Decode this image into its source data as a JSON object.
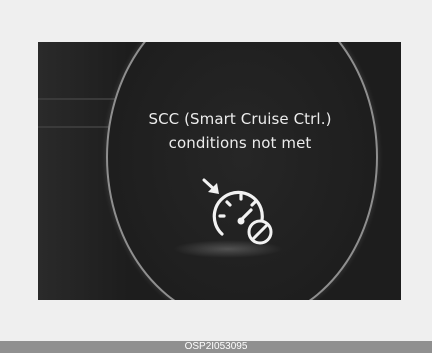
{
  "display": {
    "message_line1": "SCC (Smart Cruise Ctrl.)",
    "message_line2": "conditions not met",
    "icon": "cruise-control-unavailable-icon"
  },
  "caption": {
    "code": "OSP2I053095"
  },
  "colors": {
    "background": "#efefef",
    "display_background": "#1d1d1d",
    "ring": "#8f8f8f",
    "text": "#ececec",
    "caption_bar": "#909090"
  }
}
